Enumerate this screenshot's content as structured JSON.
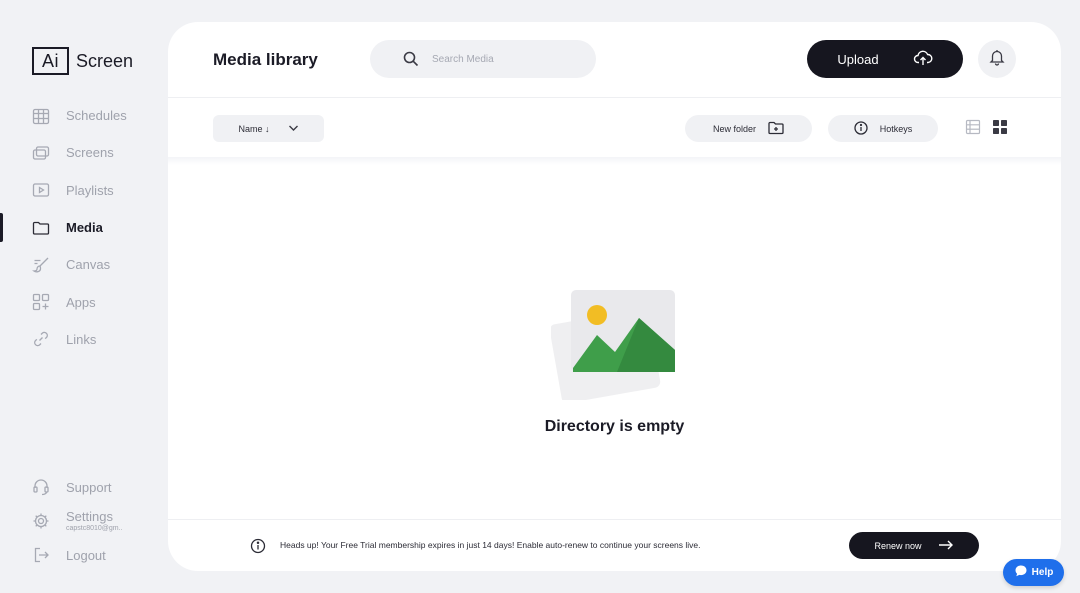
{
  "app": {
    "logo_box": "Ai",
    "logo_text": "Screen"
  },
  "sidebar": {
    "items": [
      {
        "label": "Schedules",
        "icon": "calendar-grid-icon",
        "active": false
      },
      {
        "label": "Screens",
        "icon": "screens-icon",
        "active": false
      },
      {
        "label": "Playlists",
        "icon": "playlist-icon",
        "active": false
      },
      {
        "label": "Media",
        "icon": "folder-icon",
        "active": true
      },
      {
        "label": "Canvas",
        "icon": "brush-icon",
        "active": false
      },
      {
        "label": "Apps",
        "icon": "apps-icon",
        "active": false
      },
      {
        "label": "Links",
        "icon": "link-icon",
        "active": false
      }
    ],
    "bottom": {
      "support": "Support",
      "settings": "Settings",
      "settings_email": "capstc8010@gm..",
      "logout": "Logout"
    }
  },
  "header": {
    "title": "Media library",
    "search_placeholder": "Search Media",
    "upload_label": "Upload"
  },
  "toolbar": {
    "sort_label": "Name ↓",
    "new_folder_label": "New folder",
    "hotkeys_label": "Hotkeys"
  },
  "content": {
    "empty_message": "Directory is empty"
  },
  "trial_bar": {
    "message": "Heads up! Your Free Trial membership expires in just 14 days! Enable auto-renew to continue your screens live.",
    "renew_label": "Renew now"
  },
  "help": {
    "label": "Help"
  },
  "colors": {
    "accent_dark": "#16161f",
    "help_blue": "#1f6feb",
    "mountain_green": "#3f9e4a",
    "sun_yellow": "#f2bd24"
  }
}
